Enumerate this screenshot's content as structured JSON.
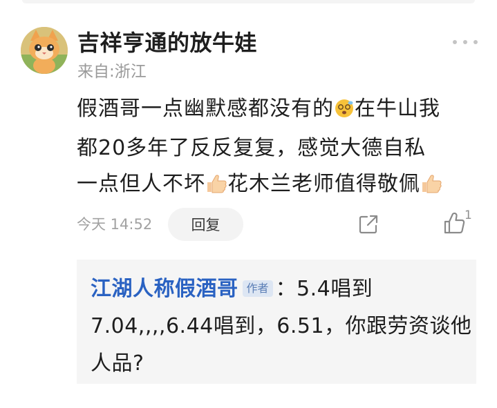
{
  "comment": {
    "username": "吉祥亨通的放牛娃",
    "location": "来自:浙江",
    "lines": [
      [
        "假酒哥一点幽默感都没有的",
        "在牛山我"
      ],
      [
        "都20多年了反反复复，感觉大德自私"
      ],
      [
        "一点但人不坏",
        "花木兰老师值得敬佩"
      ]
    ],
    "timestamp": "今天 14:52",
    "reply_label": "回复",
    "like_count": "1"
  },
  "reply": {
    "author": "江湖人称假酒哥",
    "author_badge": "作者",
    "line1": "：5.4唱到",
    "line2": "7.04,,,,6.44唱到，6.51，你跟劳资谈他",
    "line3": "人品?"
  },
  "icons": {
    "more": "more-dots-icon",
    "share": "share-icon",
    "like": "thumbs-up-icon",
    "emoji_1": "dizzy-face-emoji",
    "emoji_2": "thumbs-up-emoji"
  },
  "colors": {
    "reply_author": "#2a62c2",
    "badge_text": "#5a7db5",
    "badge_bg": "#dde6f3",
    "muted_text": "#9a9a9a",
    "reply_bg": "#f5f5f5"
  }
}
